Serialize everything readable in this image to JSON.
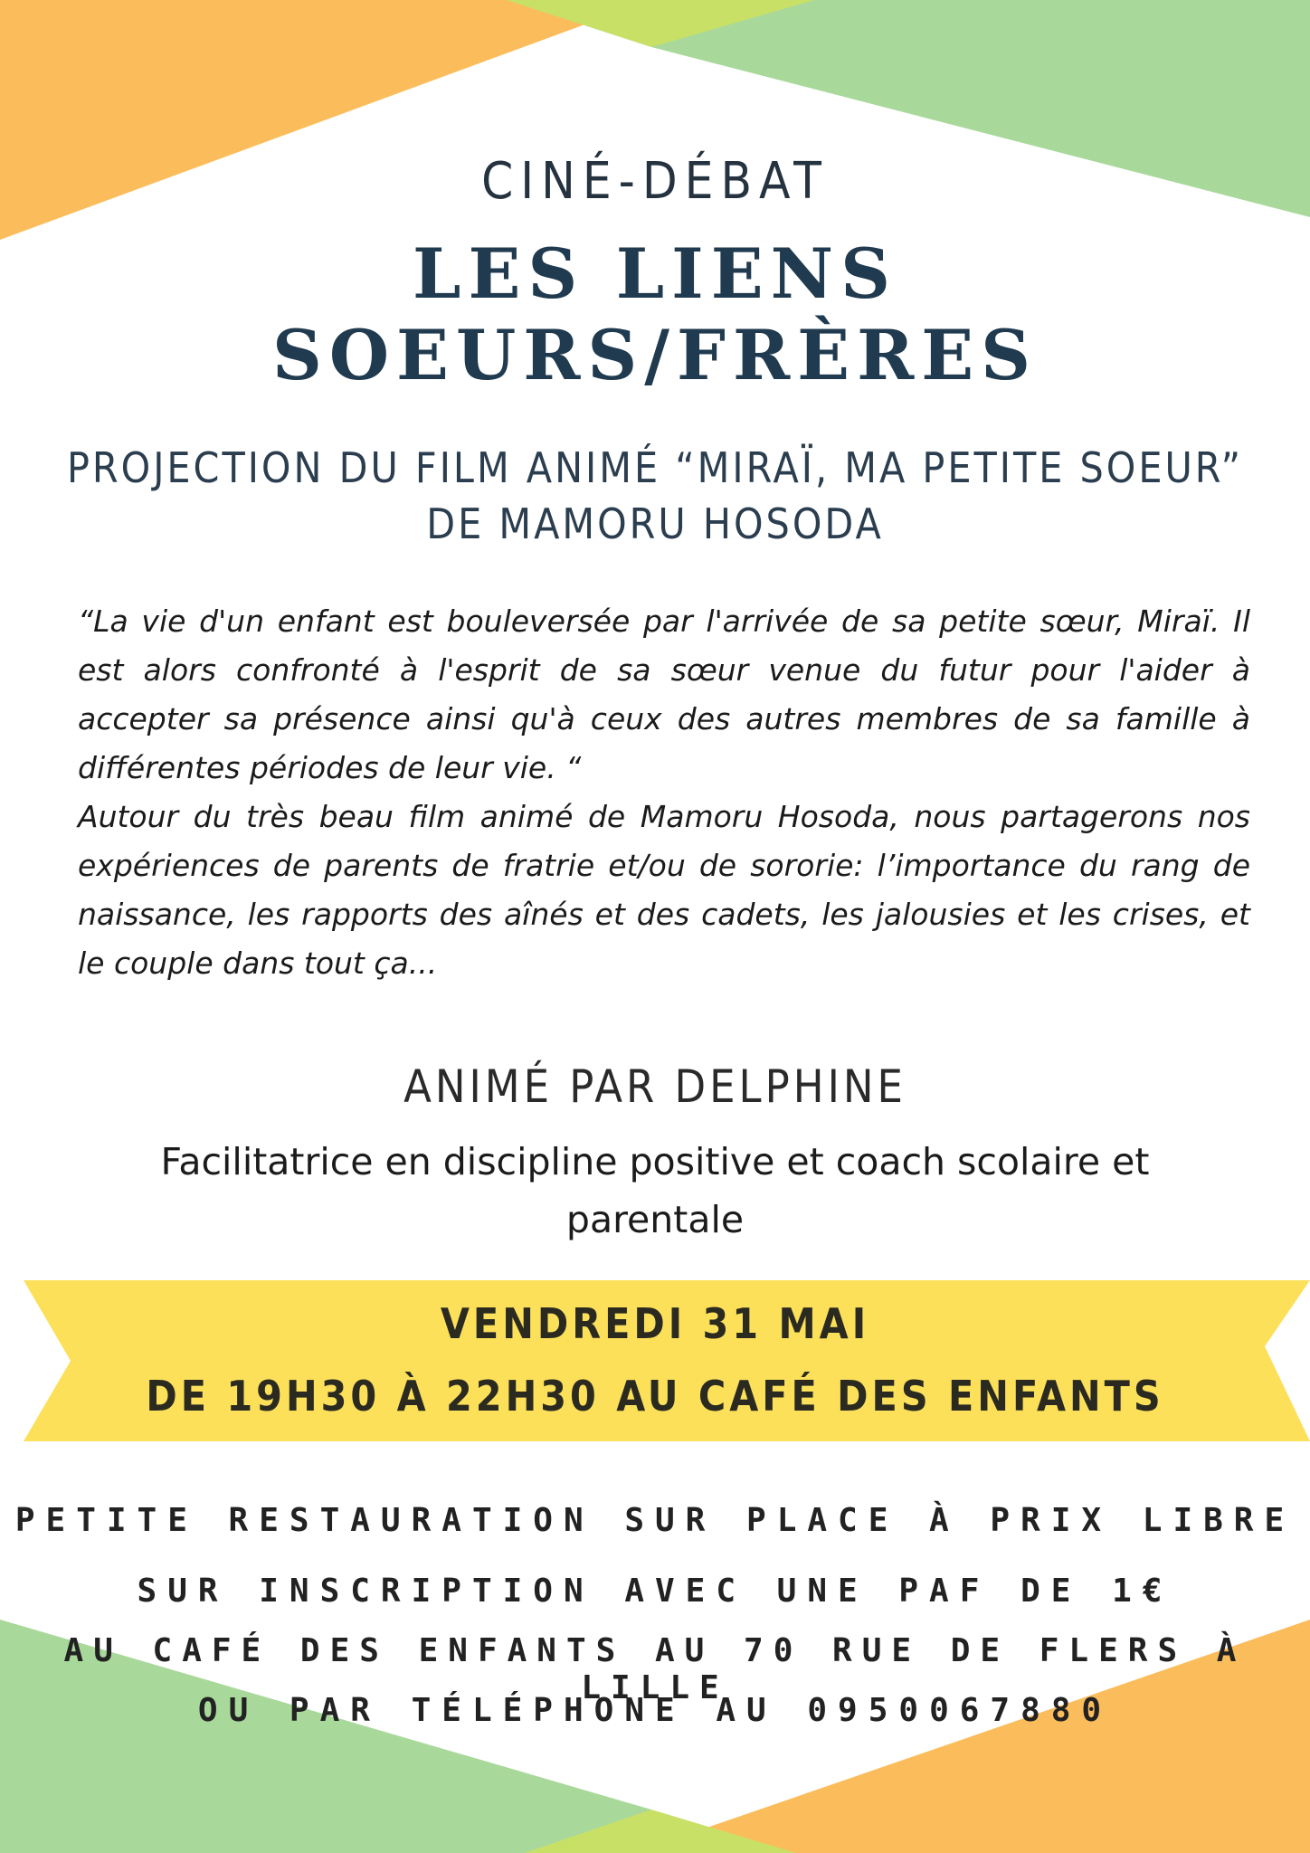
{
  "header": {
    "kicker": "CINÉ-DÉBAT",
    "title_line1": "LES LIENS",
    "title_line2": "SOEURS/FRÈRES"
  },
  "film": {
    "line1": "PROJECTION DU FILM ANIMÉ “MIRAÏ, MA PETITE SOEUR”",
    "line2": "DE MAMORU HOSODA"
  },
  "description": {
    "synopsis": "“La vie d'un enfant est bouleversée par l'arrivée de sa petite sœur, Miraï. Il est alors confronté à l'esprit de sa sœur venue du futur pour l'aider à accepter sa présence ainsi qu'à ceux des autres membres de sa famille à différentes périodes de leur vie. “",
    "discussion": "Autour du très beau film animé de Mamoru Hosoda, nous partagerons nos expériences de parents de fratrie et/ou de sororie: l’importance du rang de naissance, les rapports des aînés et des cadets, les jalousies et les crises, et le couple dans tout ça..."
  },
  "host": {
    "heading": "ANIMÉ PAR DELPHINE",
    "role": "Facilitatrice en discipline positive et coach scolaire et parentale"
  },
  "banner": {
    "date": "VENDREDI 31 MAI",
    "time_place": "DE 19H30 À 22H30 AU CAFÉ DES ENFANTS"
  },
  "practical": {
    "food": "PETITE RESTAURATION SUR PLACE À PRIX LIBRE",
    "registration": "SUR INSCRIPTION AVEC UNE PAF DE 1€",
    "address": "AU CAFÉ DES ENFANTS AU 70 RUE DE FLERS À LILLE",
    "phone": "OU PAR TÉLÉPHONE AU 0950067880"
  },
  "colors": {
    "orange": "#fbbd5b",
    "light_green": "#a8d99b",
    "lime": "#c9e067",
    "banner_yellow": "#fde05a",
    "title_navy": "#203a4f"
  }
}
